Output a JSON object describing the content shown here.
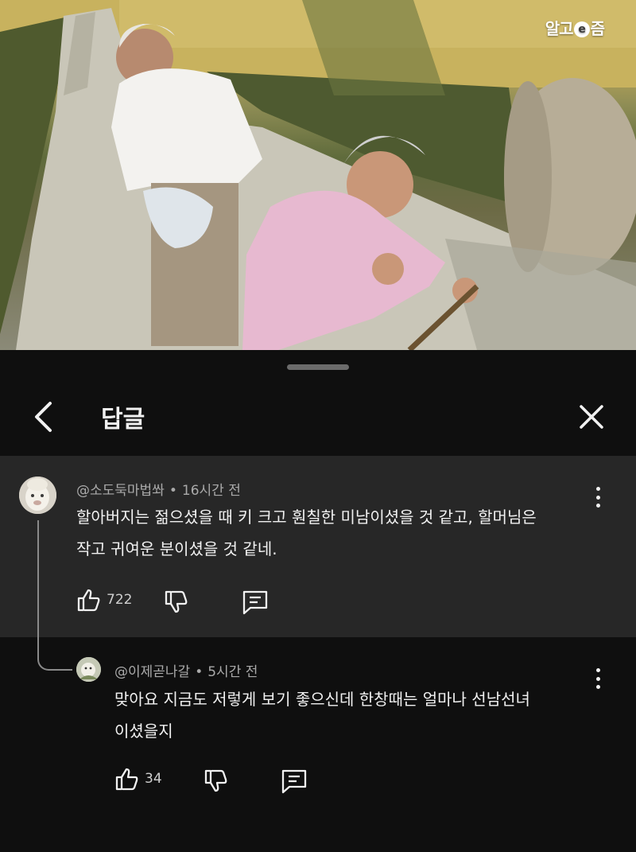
{
  "video": {
    "watermark_parts": [
      "알고",
      "e",
      "즘"
    ]
  },
  "header": {
    "title": "답글",
    "icons": {
      "back": "chevron-left-icon",
      "close": "close-icon"
    }
  },
  "comment": {
    "author": "@소도둑마법쏴",
    "time": "16시간 전",
    "separator": "•",
    "text_line1": "할아버지는 젊으셨을 때 키 크고 훤칠한 미남이셨을 것 같고, 할머님은",
    "text_line2": "작고 귀여운 분이셨을 것 같네.",
    "likes": "722"
  },
  "reply": {
    "author": "@이제곧나갈",
    "time": "5시간 전",
    "separator": "•",
    "text_line1": "맞아요 지금도 저렇게 보기 좋으신데 한창때는 얼마나 선남선녀",
    "text_line2": "이셨을지",
    "likes": "34"
  },
  "colors": {
    "background": "#0f0f0f",
    "highlight": "#272727",
    "text": "#f1f1f1",
    "meta": "#aaaaaa"
  }
}
